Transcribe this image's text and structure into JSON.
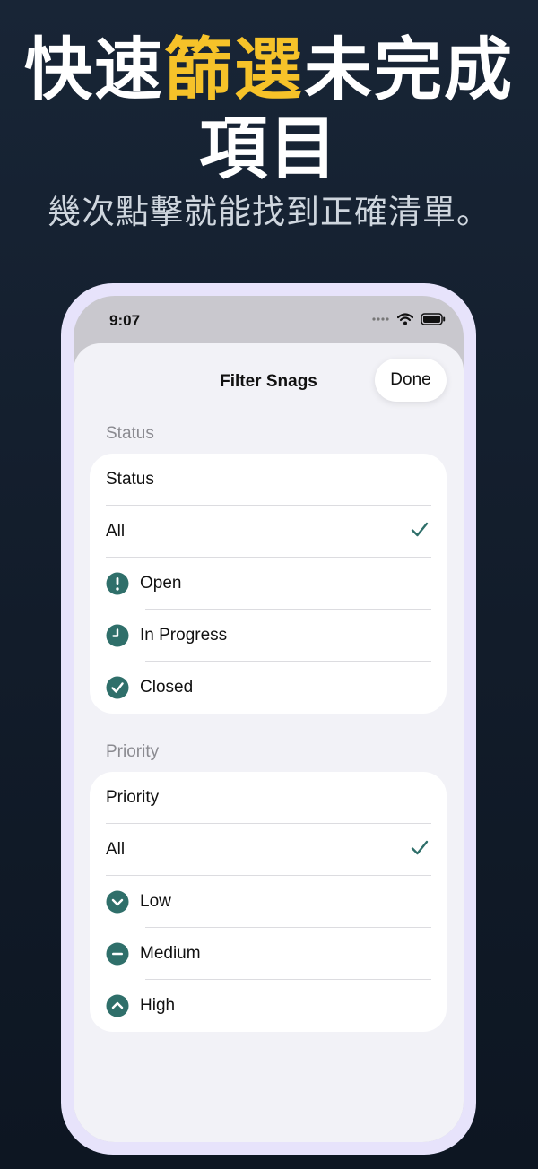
{
  "headline": {
    "part1": "快速",
    "highlight": "篩選",
    "part2": "未完成",
    "line2": "項目"
  },
  "subline": "幾次點擊就能找到正確清單。",
  "status_bar": {
    "time": "9:07"
  },
  "nav": {
    "title": "Filter Snags",
    "done_label": "Done"
  },
  "status_section": {
    "header": "Status",
    "picker_label": "Status",
    "options": [
      {
        "label": "All",
        "selected": true
      },
      {
        "label": "Open",
        "icon": "exclamation-circle-icon"
      },
      {
        "label": "In Progress",
        "icon": "clock-circle-icon"
      },
      {
        "label": "Closed",
        "icon": "checkmark-circle-icon"
      }
    ]
  },
  "priority_section": {
    "header": "Priority",
    "picker_label": "Priority",
    "options": [
      {
        "label": "All",
        "selected": true
      },
      {
        "label": "Low",
        "icon": "chevron-down-circle-icon"
      },
      {
        "label": "Medium",
        "icon": "minus-circle-icon"
      },
      {
        "label": "High",
        "icon": "chevron-up-circle-icon"
      }
    ]
  },
  "colors": {
    "accent": "#2f6f6a",
    "highlight": "#f6c229",
    "background": "#16212f"
  }
}
